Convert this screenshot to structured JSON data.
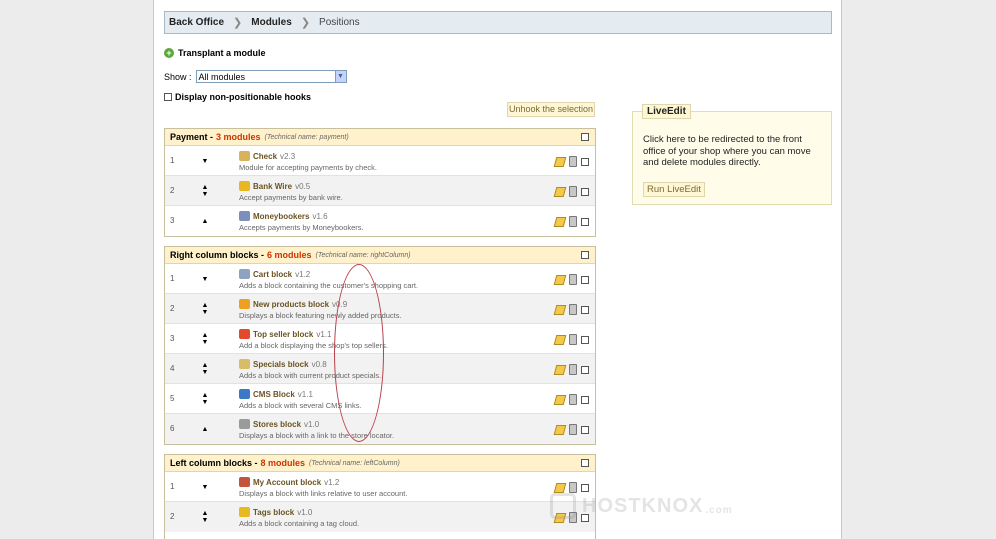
{
  "breadcrumb": {
    "items": [
      "Back Office",
      "Modules",
      "Positions"
    ]
  },
  "transplant_label": "Transplant a module",
  "show": {
    "label": "Show :",
    "value": "All modules"
  },
  "non_positionable_label": "Display non-positionable hooks",
  "unhook_label": "Unhook the selection",
  "hooks": [
    {
      "title": "Payment -",
      "count": "3 modules",
      "tech_prefix": "(Technical name:",
      "tech_name": "payment)",
      "modules": [
        {
          "pos": "1",
          "arrows": "down",
          "icon": "check-icon",
          "name": "Check",
          "version": "v2.3",
          "desc": "Module for accepting payments by check."
        },
        {
          "pos": "2",
          "arrows": "both",
          "icon": "bank-icon",
          "name": "Bank Wire",
          "version": "v0.5",
          "desc": "Accept payments by bank wire."
        },
        {
          "pos": "3",
          "arrows": "up",
          "icon": "moneybookers-icon",
          "name": "Moneybookers",
          "version": "v1.6",
          "desc": "Accepts payments by Moneybookers."
        }
      ]
    },
    {
      "title": "Right column blocks -",
      "count": "6 modules",
      "tech_prefix": "(Technical name:",
      "tech_name": "rightColumn)",
      "modules": [
        {
          "pos": "1",
          "arrows": "down",
          "icon": "cart-icon",
          "name": "Cart block",
          "version": "v1.2",
          "desc": "Adds a block containing the customer's shopping cart."
        },
        {
          "pos": "2",
          "arrows": "both",
          "icon": "new-icon",
          "name": "New products block",
          "version": "v0.9",
          "desc": "Displays a block featuring newly added products."
        },
        {
          "pos": "3",
          "arrows": "both",
          "icon": "medal-icon",
          "name": "Top seller block",
          "version": "v1.1",
          "desc": "Add a block displaying the shop's top sellers."
        },
        {
          "pos": "4",
          "arrows": "both",
          "icon": "tag-icon",
          "name": "Specials block",
          "version": "v0.8",
          "desc": "Adds a block with current product specials."
        },
        {
          "pos": "5",
          "arrows": "both",
          "icon": "info-icon",
          "name": "CMS Block",
          "version": "v1.1",
          "desc": "Adds a block with several CMS links."
        },
        {
          "pos": "6",
          "arrows": "up",
          "icon": "gear-icon",
          "name": "Stores block",
          "version": "v1.0",
          "desc": "Displays a block with a link to the store locator."
        }
      ]
    },
    {
      "title": "Left column blocks -",
      "count": "8 modules",
      "tech_prefix": "(Technical name:",
      "tech_name": "leftColumn)",
      "modules": [
        {
          "pos": "1",
          "arrows": "down",
          "icon": "user-icon",
          "name": "My Account block",
          "version": "v1.2",
          "desc": "Displays a block with links relative to user account."
        },
        {
          "pos": "2",
          "arrows": "both",
          "icon": "tags-icon",
          "name": "Tags block",
          "version": "v1.0",
          "desc": "Adds a block containing a tag cloud."
        }
      ]
    }
  ],
  "liveedit": {
    "title": "LiveEdit",
    "text": "Click here to be redirected to the front office of your shop where you can move and delete modules directly.",
    "button": "Run LiveEdit"
  },
  "watermark": {
    "text": "HOSTKNOX",
    "suffix": ".com"
  },
  "colors": {
    "accent": "#cc3300",
    "header_bg": "#fff1cc",
    "breadcrumb_bg": "#e5ecf1",
    "oval": "#b8424b"
  }
}
